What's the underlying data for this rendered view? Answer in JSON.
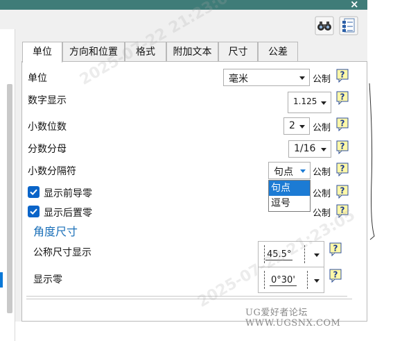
{
  "window": {
    "close_label": "×"
  },
  "toolbar": {
    "icons": [
      "binoculars-icon",
      "document-list-icon"
    ]
  },
  "tabs": [
    "单位",
    "方向和位置",
    "格式",
    "附加文本",
    "尺寸",
    "公差"
  ],
  "active_tab": "单位",
  "rows": {
    "units": {
      "label": "单位",
      "value": "毫米",
      "unit": "公制"
    },
    "numeric_display": {
      "label": "数字显示",
      "value": "1.125"
    },
    "decimal_places": {
      "label": "小数位数",
      "value": "2",
      "unit": "公制"
    },
    "fraction_denominator": {
      "label": "分数分母",
      "value": "1/16"
    },
    "decimal_separator": {
      "label": "小数分隔符",
      "value": "句点",
      "unit": "公制"
    },
    "leading_zeros": {
      "label": "显示前导零",
      "checked": true,
      "unit": "公制"
    },
    "trailing_zeros": {
      "label": "显示后置零",
      "checked": true,
      "unit": "公制"
    }
  },
  "separator_dropdown": {
    "options": [
      "句点",
      "逗号"
    ],
    "selected": "句点"
  },
  "angular": {
    "title": "角度尺寸",
    "nominal": {
      "label": "公称尺寸显示",
      "value": "45.5°"
    },
    "zeros": {
      "label": "显示零",
      "value": "0°30'"
    }
  },
  "watermarks": {
    "diagonal": "2025-07-22 21:23:05",
    "footer": "UG爱好者论坛 WWW.UGSNX.COM"
  },
  "colors": {
    "accent": "#0a64c8",
    "title_bar": "#3f7c78",
    "group_title": "#1a6fb8",
    "dropdown_highlight": "#1c7bd4"
  }
}
